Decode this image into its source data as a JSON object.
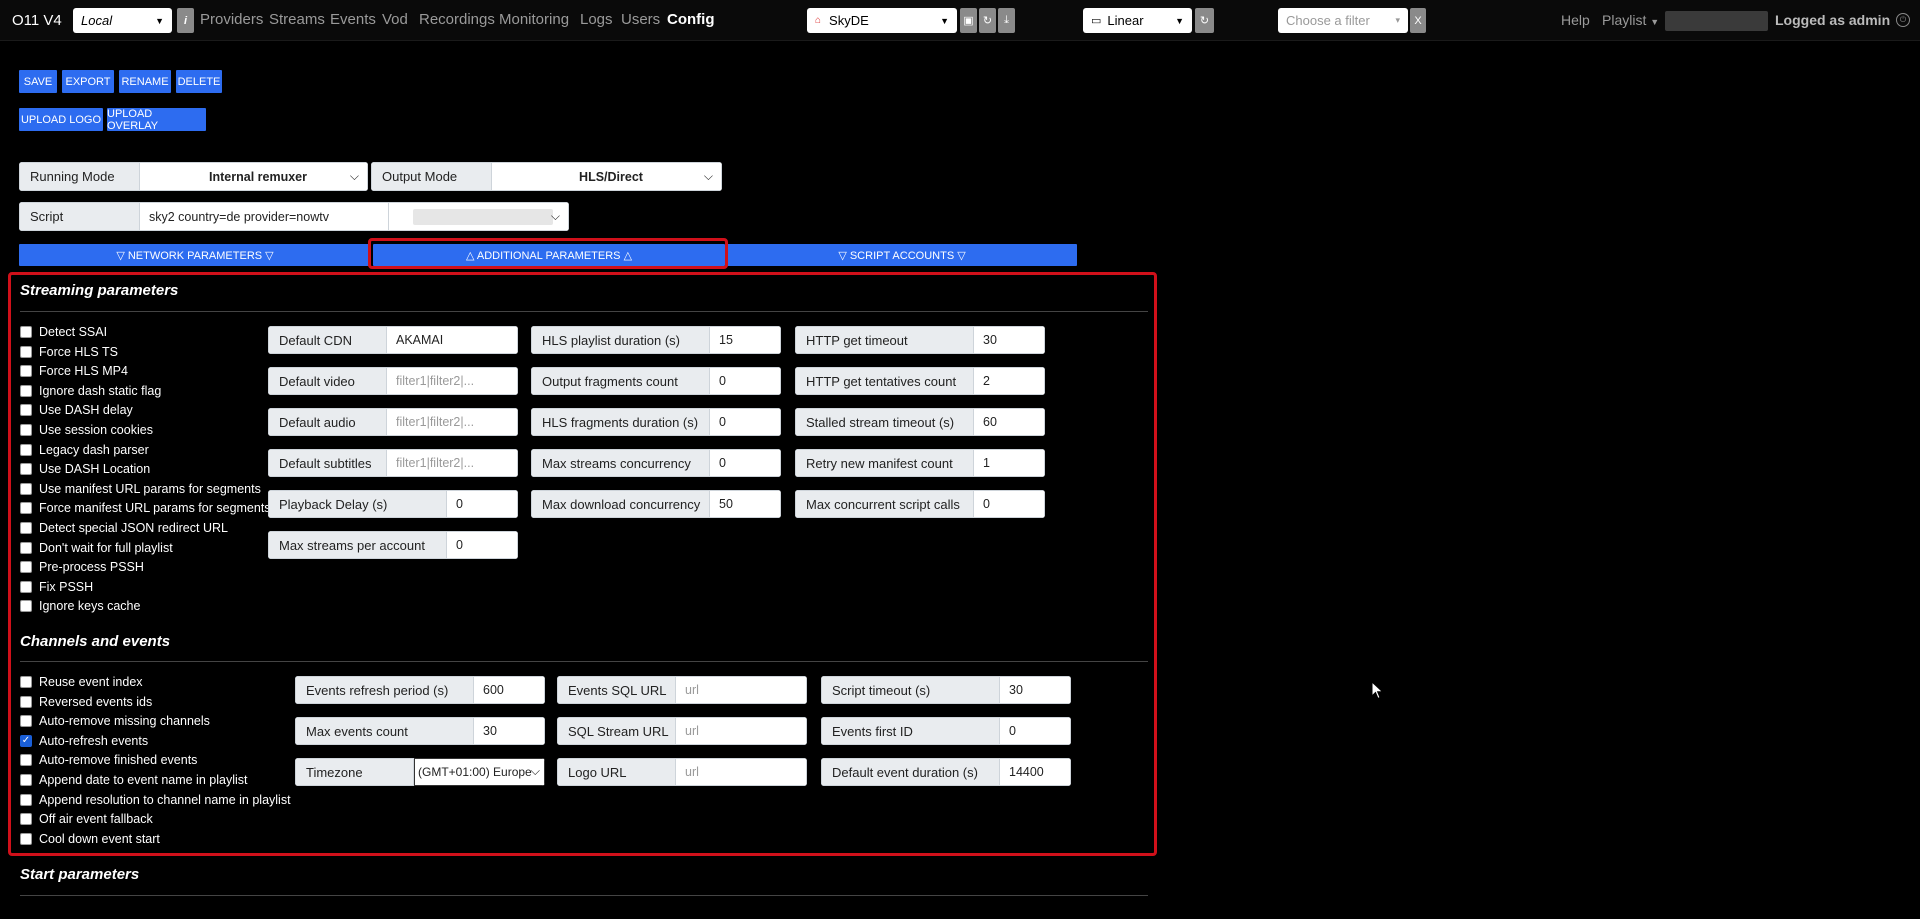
{
  "topbar": {
    "brand": "O11 V4",
    "server_select": "Local",
    "info_label": "i",
    "nav": [
      "Providers",
      "Streams",
      "Events",
      "Vod",
      "Recordings",
      "Monitoring",
      "Logs",
      "Users",
      "Config"
    ],
    "provider_select": "SkyDE",
    "mode_select": "Linear",
    "filter_placeholder": "Choose a filter",
    "filter_clear": "X",
    "help": "Help",
    "playlist": "Playlist",
    "logged": "Logged as admin"
  },
  "actions": {
    "save": "SAVE",
    "export": "EXPORT",
    "rename": "RENAME",
    "delete": "DELETE",
    "upload_logo": "UPLOAD LOGO",
    "upload_overlay": "UPLOAD OVERLAY"
  },
  "running_mode": {
    "label": "Running Mode",
    "value": "Internal remuxer"
  },
  "output_mode": {
    "label": "Output Mode",
    "value": "HLS/Direct"
  },
  "script": {
    "label": "Script",
    "value": "sky2 country=de provider=nowtv"
  },
  "tabs": {
    "network": "▽ NETWORK PARAMETERS ▽",
    "additional": "△ ADDITIONAL PARAMETERS △",
    "accounts": "▽ SCRIPT ACCOUNTS ▽"
  },
  "streaming": {
    "title": "Streaming parameters",
    "checkboxes": [
      "Detect SSAI",
      "Force HLS TS",
      "Force HLS MP4",
      "Ignore dash static flag",
      "Use DASH delay",
      "Use session cookies",
      "Legacy dash parser",
      "Use DASH Location",
      "Use manifest URL params for segments",
      "Force manifest URL params for segments",
      "Detect special JSON redirect URL",
      "Don't wait for full playlist",
      "Pre-process PSSH",
      "Fix PSSH",
      "Ignore keys cache"
    ],
    "col1": [
      {
        "label": "Default CDN",
        "value": "AKAMAI",
        "placeholder": ""
      },
      {
        "label": "Default video",
        "value": "",
        "placeholder": "filter1|filter2|..."
      },
      {
        "label": "Default audio",
        "value": "",
        "placeholder": "filter1|filter2|..."
      },
      {
        "label": "Default subtitles",
        "value": "",
        "placeholder": "filter1|filter2|..."
      },
      {
        "label": "Playback Delay (s)",
        "value": "0",
        "placeholder": ""
      },
      {
        "label": "Max streams per account",
        "value": "0",
        "placeholder": ""
      }
    ],
    "col2": [
      {
        "label": "HLS playlist duration (s)",
        "value": "15"
      },
      {
        "label": "Output fragments count",
        "value": "0"
      },
      {
        "label": "HLS fragments duration (s)",
        "value": "0"
      },
      {
        "label": "Max streams concurrency",
        "value": "0"
      },
      {
        "label": "Max download concurrency",
        "value": "50"
      }
    ],
    "col3": [
      {
        "label": "HTTP get timeout",
        "value": "30"
      },
      {
        "label": "HTTP get tentatives count",
        "value": "2"
      },
      {
        "label": "Stalled stream timeout (s)",
        "value": "60"
      },
      {
        "label": "Retry new manifest count",
        "value": "1"
      },
      {
        "label": "Max concurrent script calls",
        "value": "0"
      }
    ]
  },
  "channels": {
    "title": "Channels and events",
    "checkboxes": [
      {
        "label": "Reuse event index",
        "checked": false
      },
      {
        "label": "Reversed events ids",
        "checked": false
      },
      {
        "label": "Auto-remove missing channels",
        "checked": false
      },
      {
        "label": "Auto-refresh events",
        "checked": true
      },
      {
        "label": "Auto-remove finished events",
        "checked": false
      },
      {
        "label": "Append date to event name in playlist",
        "checked": false
      },
      {
        "label": "Append resolution to channel name in playlist",
        "checked": false
      },
      {
        "label": "Off air event fallback",
        "checked": false
      },
      {
        "label": "Cool down event start",
        "checked": false
      }
    ],
    "col1": [
      {
        "label": "Events refresh period (s)",
        "value": "600"
      },
      {
        "label": "Max events count",
        "value": "30"
      },
      {
        "label": "Timezone",
        "value": "(GMT+01:00) Europe"
      }
    ],
    "col2": [
      {
        "label": "Events SQL URL",
        "placeholder": "url"
      },
      {
        "label": "SQL Stream URL",
        "placeholder": "url"
      },
      {
        "label": "Logo URL",
        "placeholder": "url"
      }
    ],
    "col3": [
      {
        "label": "Script timeout (s)",
        "value": "30"
      },
      {
        "label": "Events first ID",
        "value": "0"
      },
      {
        "label": "Default event duration (s)",
        "value": "14400"
      }
    ]
  },
  "start": {
    "title": "Start parameters"
  }
}
